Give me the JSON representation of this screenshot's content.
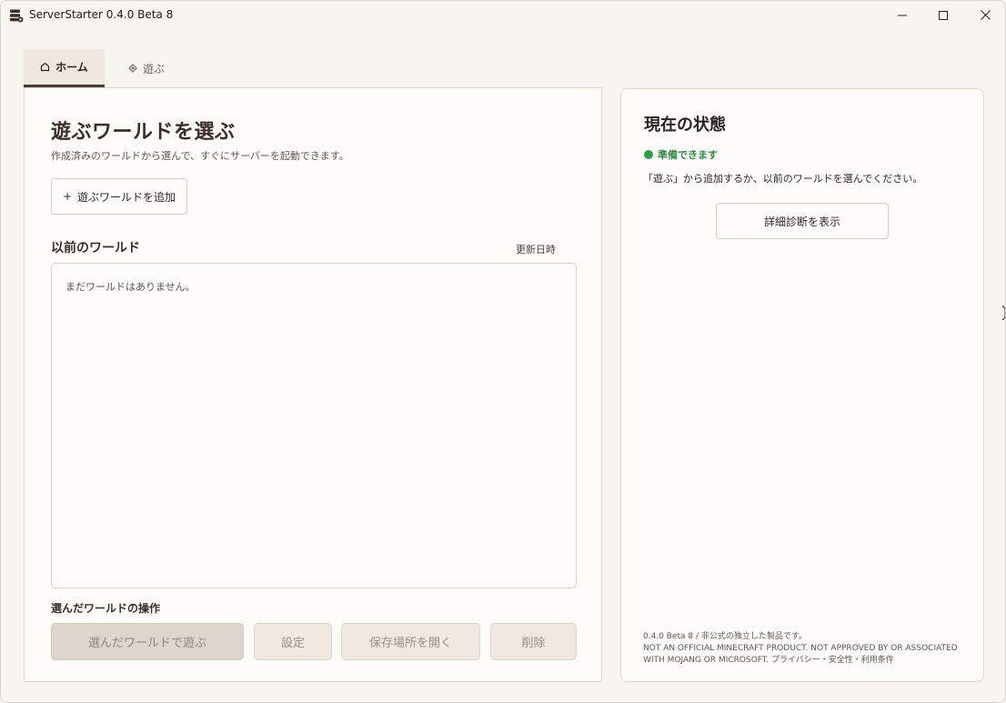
{
  "window": {
    "title": "ServerStarter 0.4.0 Beta 8",
    "icons": {
      "app": "server-stack-icon",
      "minimize": "minimize-icon",
      "maximize": "maximize-icon",
      "close": "close-icon"
    }
  },
  "tabs": [
    {
      "label": "ホーム",
      "icon": "home-icon",
      "active": true
    },
    {
      "label": "遊ぶ",
      "icon": "diamond-icon",
      "active": false
    }
  ],
  "main": {
    "heading": "遊ぶワールドを選ぶ",
    "subtitle": "作成済みのワールドから選んで、すぐにサーバーを起動できます。",
    "add_button": {
      "icon": "+",
      "label": "遊ぶワールドを追加"
    },
    "previous_worlds": {
      "heading": "以前のワールド",
      "sort_label": "更新日時",
      "empty_message": "まだワールドはありません。"
    },
    "operations": {
      "heading": "選んだワールドの操作",
      "play_label": "選んだワールドで遊ぶ",
      "settings_label": "設定",
      "open_folder_label": "保存場所を開く",
      "delete_label": "削除"
    }
  },
  "status_panel": {
    "heading": "現在の状態",
    "status_text": "準備できます",
    "status_color": "#2e9a4b",
    "description": "「遊ぶ」から追加するか、以前のワールドを選んでください。",
    "diagnostics_button": "詳細診断を表示",
    "footer_line1": "0.4.0 Beta 8 / 非公式の独立した製品です。",
    "footer_line2": "NOT AN OFFICIAL MINECRAFT PRODUCT. NOT APPROVED BY OR ASSOCIATED WITH MOJANG OR MICROSOFT.",
    "footer_links": "プライバシー・安全性・利用条件"
  }
}
